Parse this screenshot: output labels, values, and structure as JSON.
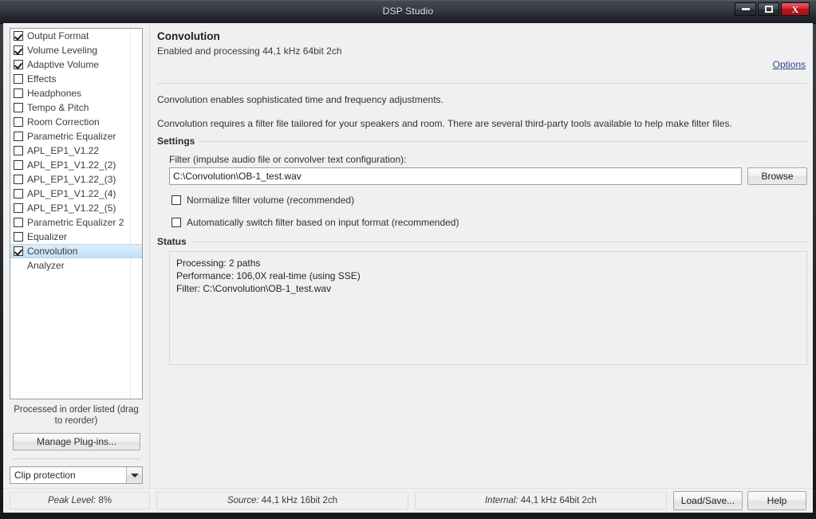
{
  "window": {
    "title": "DSP Studio",
    "controls": {
      "minimize": "minimize-icon",
      "maximize": "maximize-icon",
      "close": "X"
    }
  },
  "sidebar": {
    "items": [
      {
        "label": "Output Format",
        "checked": true,
        "has_checkbox": true,
        "selected": false
      },
      {
        "label": "Volume Leveling",
        "checked": true,
        "has_checkbox": true,
        "selected": false
      },
      {
        "label": "Adaptive Volume",
        "checked": true,
        "has_checkbox": true,
        "selected": false
      },
      {
        "label": "Effects",
        "checked": false,
        "has_checkbox": true,
        "selected": false
      },
      {
        "label": "Headphones",
        "checked": false,
        "has_checkbox": true,
        "selected": false
      },
      {
        "label": "Tempo & Pitch",
        "checked": false,
        "has_checkbox": true,
        "selected": false
      },
      {
        "label": "Room Correction",
        "checked": false,
        "has_checkbox": true,
        "selected": false
      },
      {
        "label": "Parametric Equalizer",
        "checked": false,
        "has_checkbox": true,
        "selected": false
      },
      {
        "label": "APL_EP1_V1.22",
        "checked": false,
        "has_checkbox": true,
        "selected": false
      },
      {
        "label": "APL_EP1_V1.22_(2)",
        "checked": false,
        "has_checkbox": true,
        "selected": false
      },
      {
        "label": "APL_EP1_V1.22_(3)",
        "checked": false,
        "has_checkbox": true,
        "selected": false
      },
      {
        "label": "APL_EP1_V1.22_(4)",
        "checked": false,
        "has_checkbox": true,
        "selected": false
      },
      {
        "label": "APL_EP1_V1.22_(5)",
        "checked": false,
        "has_checkbox": true,
        "selected": false
      },
      {
        "label": "Parametric Equalizer 2",
        "checked": false,
        "has_checkbox": true,
        "selected": false
      },
      {
        "label": "Equalizer",
        "checked": false,
        "has_checkbox": true,
        "selected": false
      },
      {
        "label": "Convolution",
        "checked": true,
        "has_checkbox": true,
        "selected": true
      },
      {
        "label": "Analyzer",
        "checked": false,
        "has_checkbox": false,
        "selected": false
      }
    ],
    "hint": "Processed in order listed (drag to reorder)",
    "manage_plugins_label": "Manage Plug-ins...",
    "clip_protection": {
      "selected": "Clip protection",
      "options": [
        "Clip protection"
      ]
    }
  },
  "main": {
    "title": "Convolution",
    "subtitle": "Enabled and processing 44,1 kHz 64bit 2ch",
    "options_link": "Options",
    "paragraph_1": "Convolution enables sophisticated time and frequency adjustments.",
    "paragraph_2": "Convolution requires a filter file tailored for your speakers and room.  There are several third-party tools available to help make filter files.",
    "settings": {
      "group_label": "Settings",
      "filter_caption": "Filter (impulse audio file or convolver text configuration):",
      "filter_value": "C:\\Convolution\\OB-1_test.wav",
      "filter_placeholder": "",
      "browse_label": "Browse",
      "checkbox_normalize": {
        "label": "Normalize filter volume (recommended)",
        "checked": false
      },
      "checkbox_autoswitch": {
        "label": "Automatically switch filter based on input format (recommended)",
        "checked": false
      }
    },
    "status": {
      "group_label": "Status",
      "lines": [
        "Processing: 2 paths",
        "Performance: 106,0X real-time (using SSE)",
        "Filter: C:\\Convolution\\OB-1_test.wav"
      ]
    }
  },
  "statusbar": {
    "peak_label": "Peak Level:",
    "peak_value": "8%",
    "source_label": "Source:",
    "source_value": "44,1 kHz 16bit 2ch",
    "internal_label": "Internal:",
    "internal_value": "44,1 kHz 64bit 2ch",
    "loadsave_label": "Load/Save...",
    "help_label": "Help"
  },
  "colors": {
    "accent_selection": "#cfe8fa",
    "link": "#2a4b86",
    "close_button": "#d02129",
    "window_chrome": "#2b3036",
    "client_background": "#f0f0f0"
  }
}
